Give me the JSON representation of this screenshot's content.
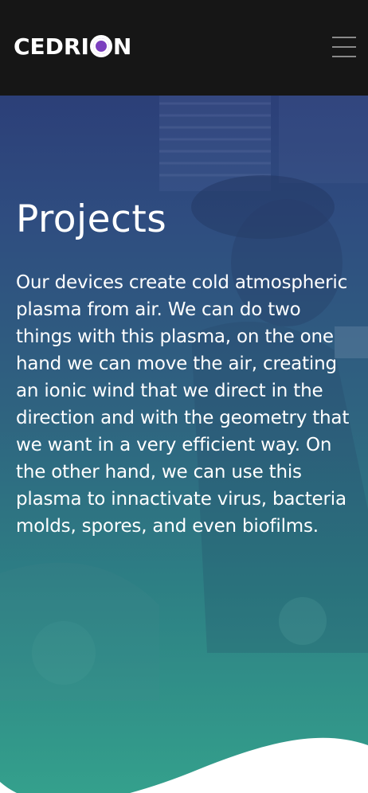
{
  "header": {
    "logo_text_left": "CEDRI",
    "logo_text_right": "N",
    "logo_accent_color": "#7b3fbf",
    "menu_icon": "hamburger-menu-icon"
  },
  "hero": {
    "title": "Projects",
    "description": "Our devices create cold atmospheric plasma from air. We can do two things with this plasma, on the one hand we can move the air, creating an ionic wind that we direct in the direction and with the geometry that we want in a very efficient way. On the other hand, we can use this plasma to innactivate virus, bacteria molds, spores, and even biofilms.",
    "gradient_top": "#2c3f78",
    "gradient_bottom": "#34a08c"
  }
}
